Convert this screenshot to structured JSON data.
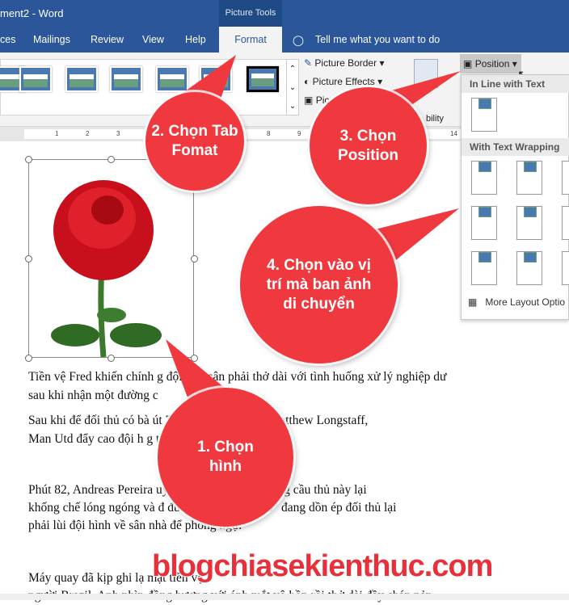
{
  "title": "ment2  -  Word",
  "context_tab": "Picture Tools",
  "tabs": [
    "ces",
    "Mailings",
    "Review",
    "View",
    "Help",
    "Format"
  ],
  "tell_me": "Tell me what you want to do",
  "ribbon": {
    "picture_border": "Picture Border",
    "picture_effects": "Picture Effects",
    "picture_layout": "Pic",
    "accessibility": "bility",
    "position": "Position"
  },
  "ruler": [
    "1",
    "2",
    "3",
    "8",
    "9",
    "14"
  ],
  "position_panel": {
    "inline_header": "In Line with Text",
    "wrap_header": "With Text Wrapping",
    "more": "More Layout Optio"
  },
  "paragraphs": [
    "Tiền vệ Fred khiến chính         g đội trên sân phải thở dài với tình huống xử lý nghiệp dư",
    "sau khi nhận một đường c",
    "Sau khi để đối thủ có bà                          út 72 với cú sút xa của Matthew Longstaff,",
    "Man Utd đẩy cao đội h                             g tìm kiếm bàn gỡ.",
    "Phút 82, Andreas Pereira                          uyền ngắn cho Fred nhưng cầu thủ này lại",
    "khống chế lóng ngóng và đ                       đường biên. \"Quỷ đỏ\" đang dồn ép đối thủ lại",
    "phải lùi đội hình về sân nhà để phòng ngự.",
    "Máy quay đã kịp ghi lạ                                                                    mặt tiền vệ",
    "người Brazil. Anh nhìn đồng hương với ánh mắt vô hồn rồi thở dài đầy chán nản."
  ],
  "bubbles": {
    "b1": "1. Chọn hình",
    "b2": "2. Chọn Tab Fomat",
    "b3": "3. Chọn Position",
    "b4": "4. Chọn vào vị trí mà ban ảnh di chuyển"
  },
  "watermark": "blogchiasekienthuc.com",
  "colors": {
    "ribbon_blue": "#2b579a",
    "bubble_red": "#f0393f"
  }
}
